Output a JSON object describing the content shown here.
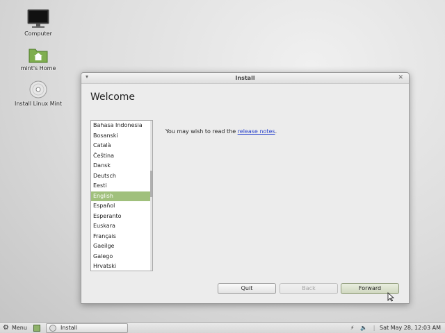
{
  "desktop": {
    "icons": [
      {
        "label": "Computer",
        "icon": "monitor-icon"
      },
      {
        "label": "mint's Home",
        "icon": "home-folder-icon"
      },
      {
        "label": "Install Linux Mint",
        "icon": "disc-icon"
      }
    ]
  },
  "window": {
    "title": "Install",
    "heading": "Welcome",
    "languages": [
      "Bahasa Indonesia",
      "Bosanski",
      "Català",
      "Čeština",
      "Dansk",
      "Deutsch",
      "Eesti",
      "English",
      "Español",
      "Esperanto",
      "Euskara",
      "Français",
      "Gaeilge",
      "Galego",
      "Hrvatski"
    ],
    "selected_language": "English",
    "notes_prefix": "You may wish to read the ",
    "notes_link": "release notes",
    "notes_suffix": ".",
    "buttons": {
      "quit": "Quit",
      "back": "Back",
      "forward": "Forward"
    }
  },
  "panel": {
    "menu_label": "Menu",
    "task_label": "Install",
    "clock": "Sat May 28, 12:03 AM"
  },
  "colors": {
    "selection": "#a0c07c",
    "link": "#2b44cc",
    "mint_green": "#8fb26a"
  }
}
